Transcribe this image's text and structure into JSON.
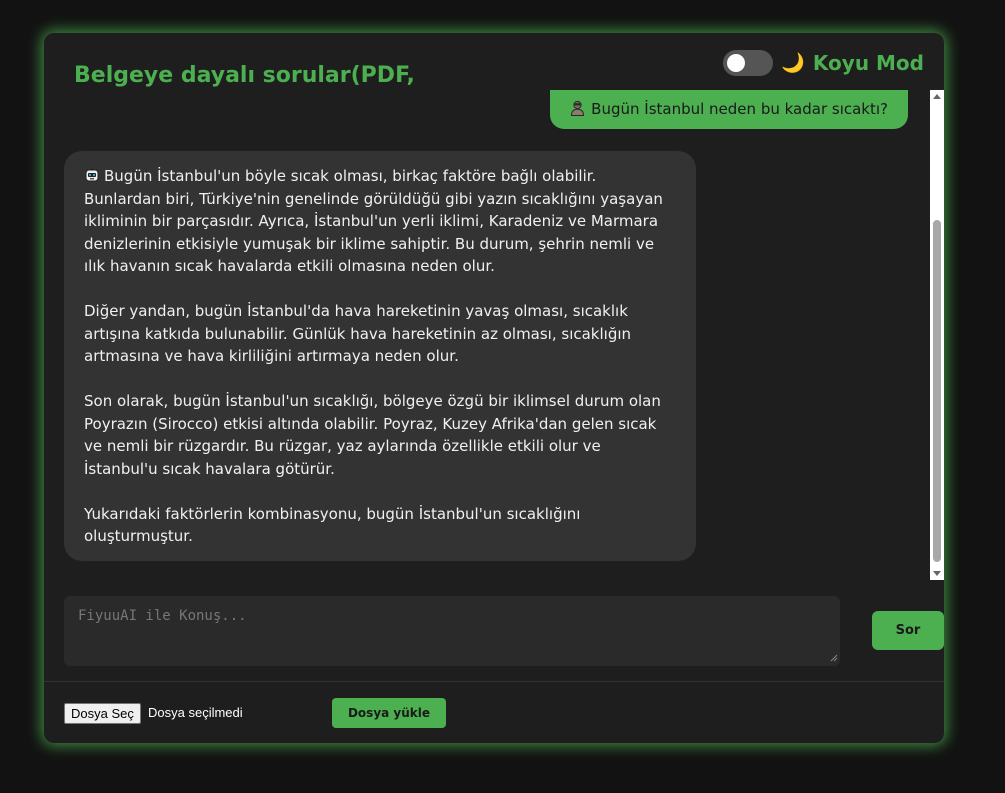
{
  "header": {
    "title": "Belgeye dayalı sorular(PDF,",
    "theme_toggle": {
      "moon_icon": "🌙",
      "label": "Koyu Mod",
      "checked": false
    }
  },
  "chat": {
    "messages": [
      {
        "role": "user",
        "icon": "user-avatar-icon",
        "text": "Bugün İstanbul neden bu kadar sıcaktı?"
      },
      {
        "role": "bot",
        "icon": "robot-icon",
        "paragraphs": [
          "Bugün İstanbul'un böyle sıcak olması, birkaç faktöre bağlı olabilir. Bunlardan biri, Türkiye'nin genelinde görüldüğü gibi yazın sıcaklığını yaşayan ikliminin bir parçasıdır. Ayrıca, İstanbul'un yerli iklimi, Karadeniz ve Marmara denizlerinin etkisiyle yumuşak bir iklime sahiptir. Bu durum, şehrin nemli ve ılık havanın sıcak havalarda etkili olmasına neden olur.",
          "Diğer yandan, bugün İstanbul'da hava hareketinin yavaş olması, sıcaklık artışına katkıda bulunabilir. Günlük hava hareketinin az olması, sıcaklığın artmasına ve hava kirliliğini artırmaya neden olur.",
          "Son olarak, bugün İstanbul'un sıcaklığı, bölgeye özgü bir iklimsel durum olan Poyrazın (Sirocco) etkisi altında olabilir. Poyraz, Kuzey Afrika'dan gelen sıcak ve nemli bir rüzgardır. Bu rüzgar, yaz aylarında özellikle etkili olur ve İstanbul'u sıcak havalara götürür.",
          "Yukarıdaki faktörlerin kombinasyonu, bugün İstanbul'un sıcaklığını oluşturmuştur."
        ]
      }
    ]
  },
  "input": {
    "placeholder": "FiyuuAI ile Konuş...",
    "value": "",
    "submit_label": "Sor"
  },
  "upload": {
    "choose_label": "Dosya Seç",
    "status": "Dosya seçilmedi",
    "upload_label": "Dosya yükle"
  },
  "colors": {
    "accent": "#4caf50",
    "page_bg": "#121212",
    "panel_bg": "#1e1e1e",
    "bot_bubble": "#333333",
    "input_bg": "#2a2a2a"
  }
}
